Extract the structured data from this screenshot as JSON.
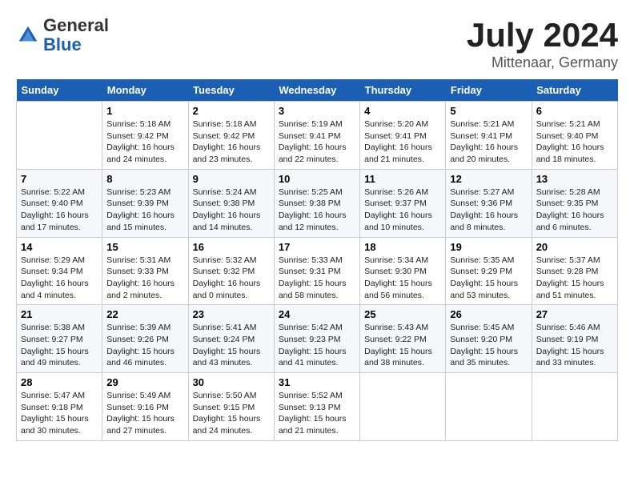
{
  "header": {
    "logo": {
      "general": "General",
      "blue": "Blue"
    },
    "title": "July 2024",
    "location": "Mittenaar, Germany"
  },
  "columns": [
    "Sunday",
    "Monday",
    "Tuesday",
    "Wednesday",
    "Thursday",
    "Friday",
    "Saturday"
  ],
  "weeks": [
    [
      {
        "day": null,
        "info": null
      },
      {
        "day": "1",
        "info": "Sunrise: 5:18 AM\nSunset: 9:42 PM\nDaylight: 16 hours\nand 24 minutes."
      },
      {
        "day": "2",
        "info": "Sunrise: 5:18 AM\nSunset: 9:42 PM\nDaylight: 16 hours\nand 23 minutes."
      },
      {
        "day": "3",
        "info": "Sunrise: 5:19 AM\nSunset: 9:41 PM\nDaylight: 16 hours\nand 22 minutes."
      },
      {
        "day": "4",
        "info": "Sunrise: 5:20 AM\nSunset: 9:41 PM\nDaylight: 16 hours\nand 21 minutes."
      },
      {
        "day": "5",
        "info": "Sunrise: 5:21 AM\nSunset: 9:41 PM\nDaylight: 16 hours\nand 20 minutes."
      },
      {
        "day": "6",
        "info": "Sunrise: 5:21 AM\nSunset: 9:40 PM\nDaylight: 16 hours\nand 18 minutes."
      }
    ],
    [
      {
        "day": "7",
        "info": "Sunrise: 5:22 AM\nSunset: 9:40 PM\nDaylight: 16 hours\nand 17 minutes."
      },
      {
        "day": "8",
        "info": "Sunrise: 5:23 AM\nSunset: 9:39 PM\nDaylight: 16 hours\nand 15 minutes."
      },
      {
        "day": "9",
        "info": "Sunrise: 5:24 AM\nSunset: 9:38 PM\nDaylight: 16 hours\nand 14 minutes."
      },
      {
        "day": "10",
        "info": "Sunrise: 5:25 AM\nSunset: 9:38 PM\nDaylight: 16 hours\nand 12 minutes."
      },
      {
        "day": "11",
        "info": "Sunrise: 5:26 AM\nSunset: 9:37 PM\nDaylight: 16 hours\nand 10 minutes."
      },
      {
        "day": "12",
        "info": "Sunrise: 5:27 AM\nSunset: 9:36 PM\nDaylight: 16 hours\nand 8 minutes."
      },
      {
        "day": "13",
        "info": "Sunrise: 5:28 AM\nSunset: 9:35 PM\nDaylight: 16 hours\nand 6 minutes."
      }
    ],
    [
      {
        "day": "14",
        "info": "Sunrise: 5:29 AM\nSunset: 9:34 PM\nDaylight: 16 hours\nand 4 minutes."
      },
      {
        "day": "15",
        "info": "Sunrise: 5:31 AM\nSunset: 9:33 PM\nDaylight: 16 hours\nand 2 minutes."
      },
      {
        "day": "16",
        "info": "Sunrise: 5:32 AM\nSunset: 9:32 PM\nDaylight: 16 hours\nand 0 minutes."
      },
      {
        "day": "17",
        "info": "Sunrise: 5:33 AM\nSunset: 9:31 PM\nDaylight: 15 hours\nand 58 minutes."
      },
      {
        "day": "18",
        "info": "Sunrise: 5:34 AM\nSunset: 9:30 PM\nDaylight: 15 hours\nand 56 minutes."
      },
      {
        "day": "19",
        "info": "Sunrise: 5:35 AM\nSunset: 9:29 PM\nDaylight: 15 hours\nand 53 minutes."
      },
      {
        "day": "20",
        "info": "Sunrise: 5:37 AM\nSunset: 9:28 PM\nDaylight: 15 hours\nand 51 minutes."
      }
    ],
    [
      {
        "day": "21",
        "info": "Sunrise: 5:38 AM\nSunset: 9:27 PM\nDaylight: 15 hours\nand 49 minutes."
      },
      {
        "day": "22",
        "info": "Sunrise: 5:39 AM\nSunset: 9:26 PM\nDaylight: 15 hours\nand 46 minutes."
      },
      {
        "day": "23",
        "info": "Sunrise: 5:41 AM\nSunset: 9:24 PM\nDaylight: 15 hours\nand 43 minutes."
      },
      {
        "day": "24",
        "info": "Sunrise: 5:42 AM\nSunset: 9:23 PM\nDaylight: 15 hours\nand 41 minutes."
      },
      {
        "day": "25",
        "info": "Sunrise: 5:43 AM\nSunset: 9:22 PM\nDaylight: 15 hours\nand 38 minutes."
      },
      {
        "day": "26",
        "info": "Sunrise: 5:45 AM\nSunset: 9:20 PM\nDaylight: 15 hours\nand 35 minutes."
      },
      {
        "day": "27",
        "info": "Sunrise: 5:46 AM\nSunset: 9:19 PM\nDaylight: 15 hours\nand 33 minutes."
      }
    ],
    [
      {
        "day": "28",
        "info": "Sunrise: 5:47 AM\nSunset: 9:18 PM\nDaylight: 15 hours\nand 30 minutes."
      },
      {
        "day": "29",
        "info": "Sunrise: 5:49 AM\nSunset: 9:16 PM\nDaylight: 15 hours\nand 27 minutes."
      },
      {
        "day": "30",
        "info": "Sunrise: 5:50 AM\nSunset: 9:15 PM\nDaylight: 15 hours\nand 24 minutes."
      },
      {
        "day": "31",
        "info": "Sunrise: 5:52 AM\nSunset: 9:13 PM\nDaylight: 15 hours\nand 21 minutes."
      },
      {
        "day": null,
        "info": null
      },
      {
        "day": null,
        "info": null
      },
      {
        "day": null,
        "info": null
      }
    ]
  ]
}
